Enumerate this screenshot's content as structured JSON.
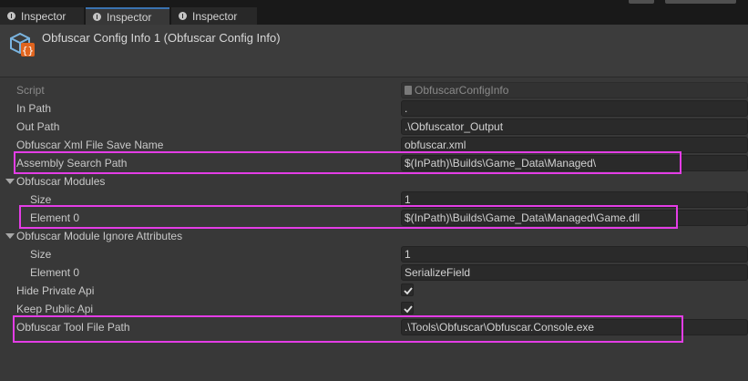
{
  "tabs": [
    {
      "label": "Inspector"
    },
    {
      "label": "Inspector"
    },
    {
      "label": "Inspector"
    }
  ],
  "header": {
    "title": "Obfuscar Config Info 1 (Obfuscar Config Info)"
  },
  "fields": {
    "script": {
      "label": "Script",
      "value": "ObfuscarConfigInfo"
    },
    "in_path": {
      "label": "In Path",
      "value": "."
    },
    "out_path": {
      "label": "Out Path",
      "value": ".\\Obfuscator_Output"
    },
    "xml_save_name": {
      "label": "Obfuscar Xml File Save Name",
      "value": "obfuscar.xml"
    },
    "assembly_search_path": {
      "label": "Assembly Search Path",
      "value": "$(InPath)\\Builds\\Game_Data\\Managed\\"
    },
    "modules": {
      "label": "Obfuscar Modules",
      "size_label": "Size",
      "size": "1",
      "element0_label": "Element 0",
      "element0": "$(InPath)\\Builds\\Game_Data\\Managed\\Game.dll"
    },
    "ignore_attributes": {
      "label": "Obfuscar Module Ignore Attributes",
      "size_label": "Size",
      "size": "1",
      "element0_label": "Element 0",
      "element0": "SerializeField"
    },
    "hide_private_api": {
      "label": "Hide Private Api",
      "checked": true
    },
    "keep_public_api": {
      "label": "Keep Public Api",
      "checked": true
    },
    "tool_file_path": {
      "label": "Obfuscar Tool File Path",
      "value": ".\\Tools\\Obfuscar\\Obfuscar.Console.exe"
    }
  },
  "colors": {
    "highlight": "#e43de6",
    "accent": "#3a72b0"
  },
  "icons": {
    "tab": "info-icon",
    "component": "script-config-icon",
    "script_field": "script-file-icon",
    "check": "checkmark-icon"
  }
}
